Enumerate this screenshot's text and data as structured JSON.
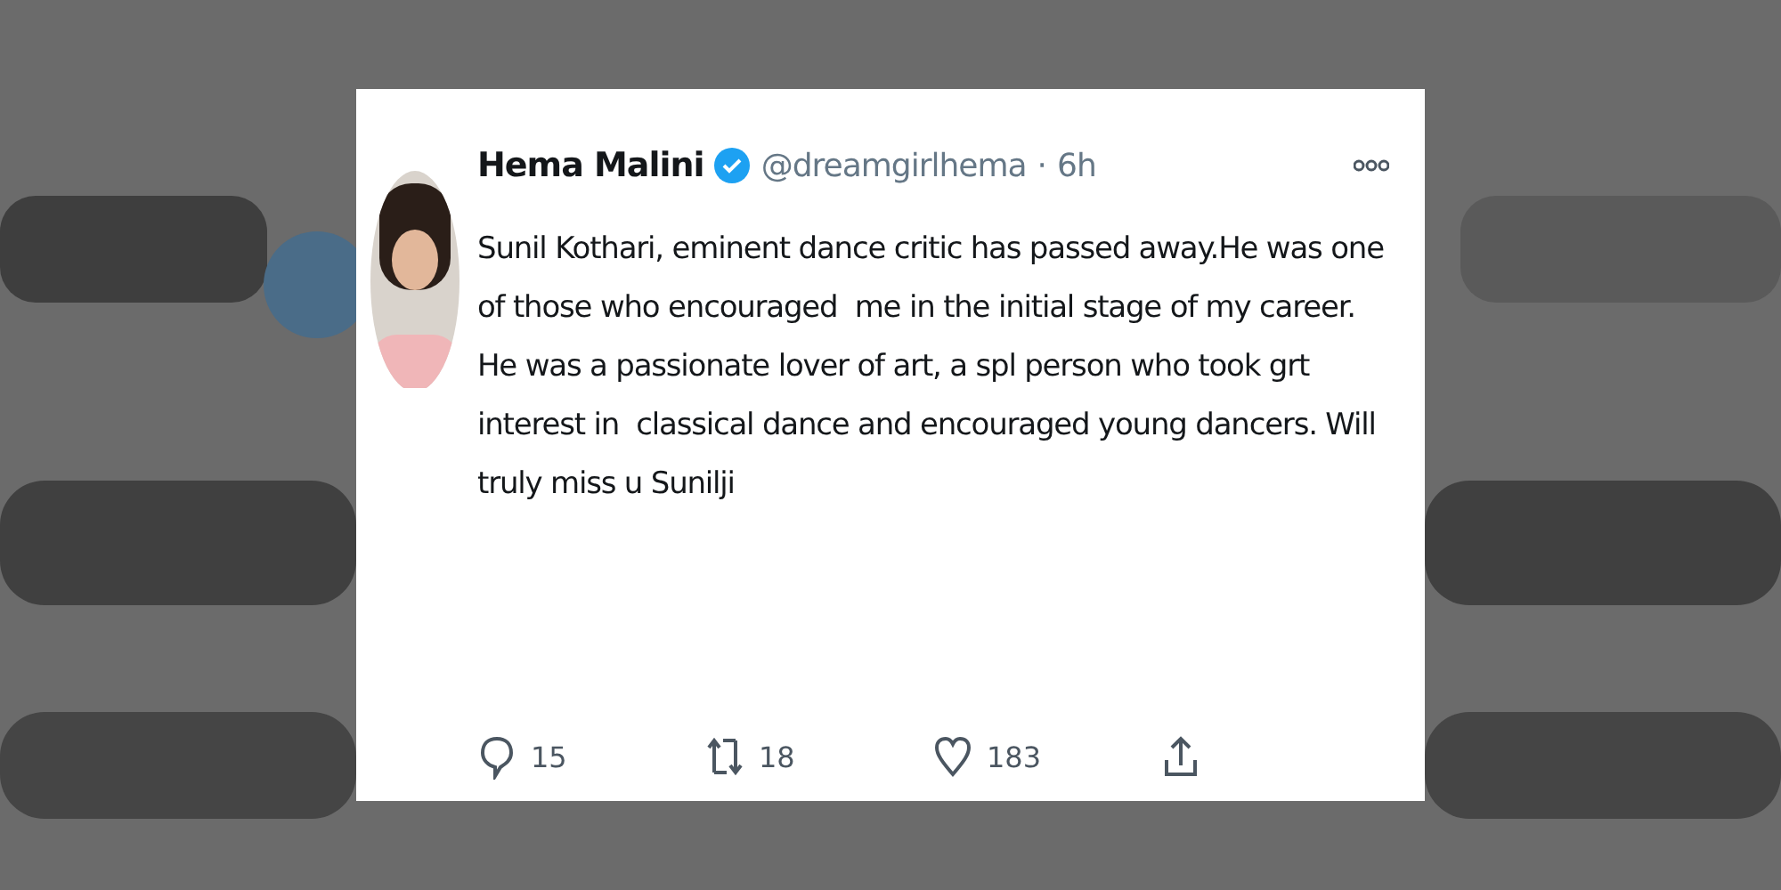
{
  "tweet": {
    "name": "Hema Malini",
    "verified": true,
    "handle": "@dreamgirlhema",
    "separator": "·",
    "time": "6h",
    "text": "Sunil Kothari, eminent dance critic has passed away.He was one of those who encouraged  me in the initial stage of my career. He was a passionate lover of art, a spl person who took grt interest in  classical dance and encouraged young dancers. Will truly miss u Sunilji",
    "actions": [
      {
        "kind": "reply",
        "count": "15"
      },
      {
        "kind": "retweet",
        "count": "18"
      },
      {
        "kind": "like",
        "count": "183"
      },
      {
        "kind": "share"
      }
    ]
  }
}
